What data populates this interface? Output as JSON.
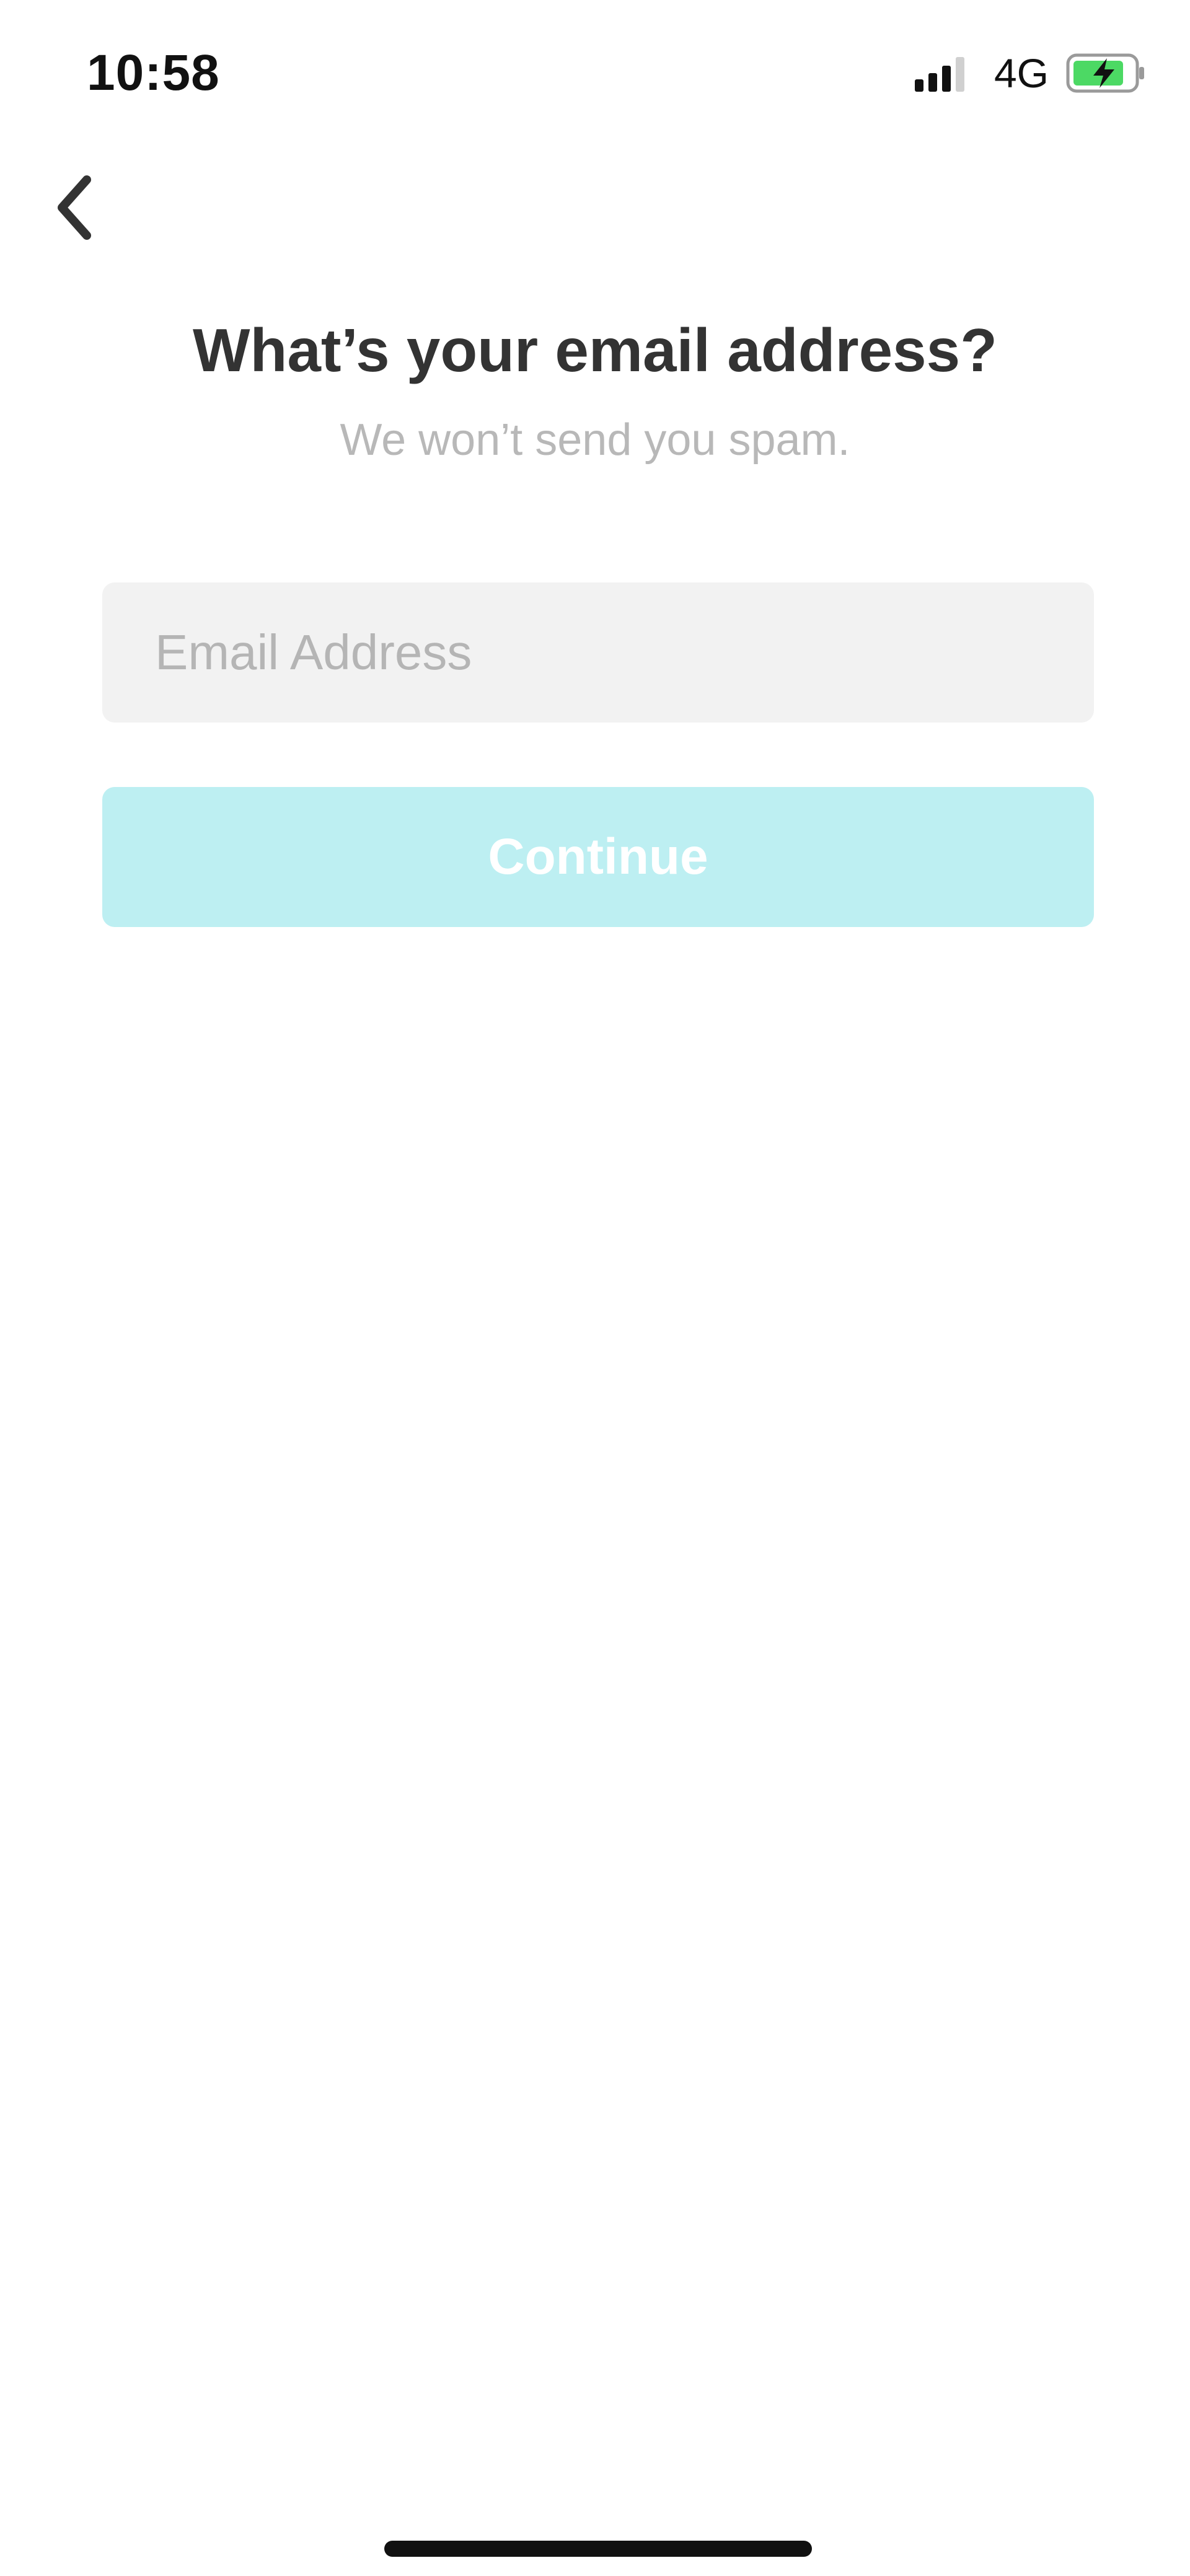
{
  "status_bar": {
    "time": "10:58",
    "network": "4G",
    "signal_bars": 3,
    "signal_bars_total": 4,
    "battery_charging": true,
    "battery_color": "#4cd964"
  },
  "nav": {
    "back_icon": "chevron-left-icon"
  },
  "header": {
    "title": "What’s your email address?",
    "subtitle": "We won’t send you spam."
  },
  "form": {
    "email": {
      "value": "",
      "placeholder": "Email Address"
    },
    "continue_label": "Continue",
    "continue_color": "#bdeff2"
  }
}
